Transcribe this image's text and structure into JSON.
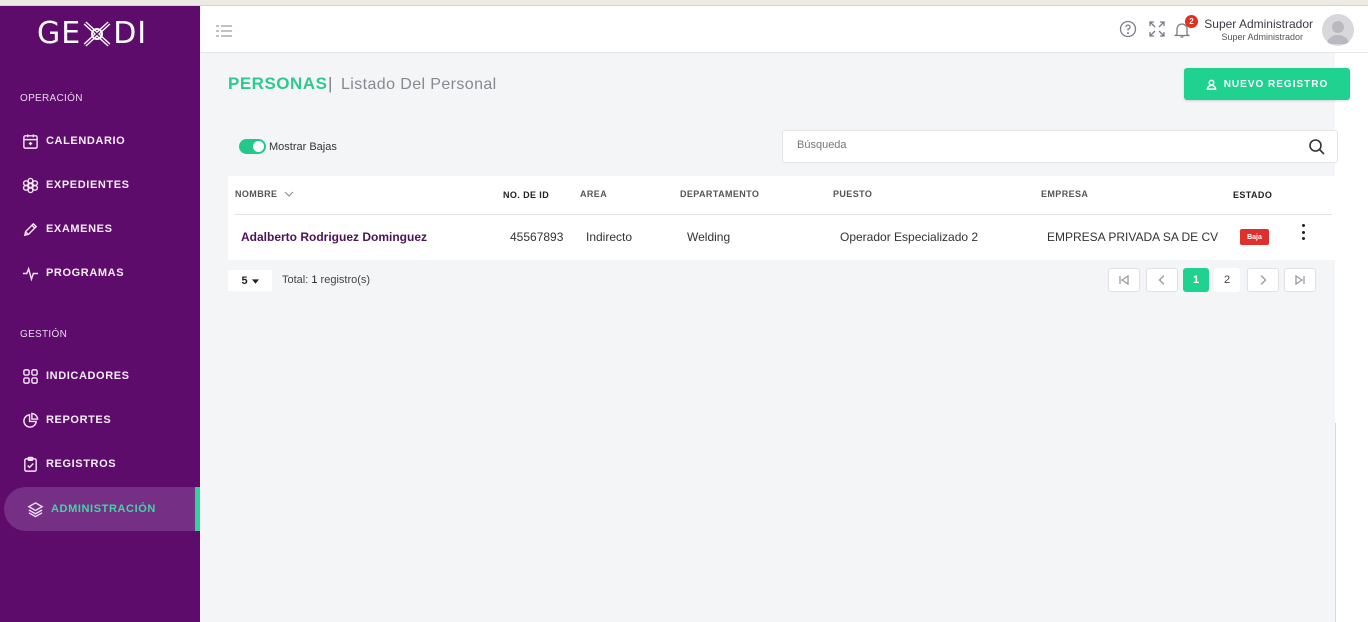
{
  "app": {
    "logo": "GEXDI"
  },
  "sidebar": {
    "sections": [
      {
        "label": "OPERACIÓN"
      },
      {
        "label": "GESTIÓN"
      }
    ],
    "items": [
      {
        "label": "CALENDARIO",
        "icon": "calendar-icon"
      },
      {
        "label": "EXPEDIENTES",
        "icon": "flower-icon"
      },
      {
        "label": "EXAMENES",
        "icon": "pen-icon"
      },
      {
        "label": "PROGRAMAS",
        "icon": "activity-icon"
      },
      {
        "label": "INDICADORES",
        "icon": "grid-icon"
      },
      {
        "label": "REPORTES",
        "icon": "pie-chart-icon"
      },
      {
        "label": "REGISTROS",
        "icon": "clipboard-icon"
      },
      {
        "label": "ADMINISTRACIÓN",
        "icon": "layers-icon",
        "active": true
      }
    ]
  },
  "header": {
    "notification_count": "2",
    "user_name": "Super Administrador",
    "user_role": "Super Administrador"
  },
  "page": {
    "title": "PERSONAS",
    "separator": "|",
    "subtitle": "Listado Del Personal",
    "new_button": "NUEVO REGISTRO",
    "toggle_label": "Mostrar Bajas",
    "search_placeholder": "Búsqueda"
  },
  "table": {
    "columns": [
      "NOMBRE",
      "NO. DE ID",
      "AREA",
      "DEPARTAMENTO",
      "PUESTO",
      "EMPRESA",
      "ESTADO"
    ],
    "rows": [
      {
        "nombre": "Adalberto Rodriguez Dominguez",
        "id": "45567893",
        "area": "Indirecto",
        "departamento": "Welding",
        "puesto": "Operador Especializado 2",
        "empresa": "EMPRESA PRIVADA SA DE CV",
        "estado": "Baja"
      }
    ]
  },
  "pagination": {
    "per_page": "5",
    "total_prefix": "Total:",
    "total_count": "1",
    "total_suffix": "registro(s)",
    "pages": [
      "1",
      "2"
    ],
    "current_page": "1"
  },
  "colors": {
    "sidebar": "#5e0c6b",
    "accent": "#1fd28f",
    "danger": "#e0302d"
  }
}
